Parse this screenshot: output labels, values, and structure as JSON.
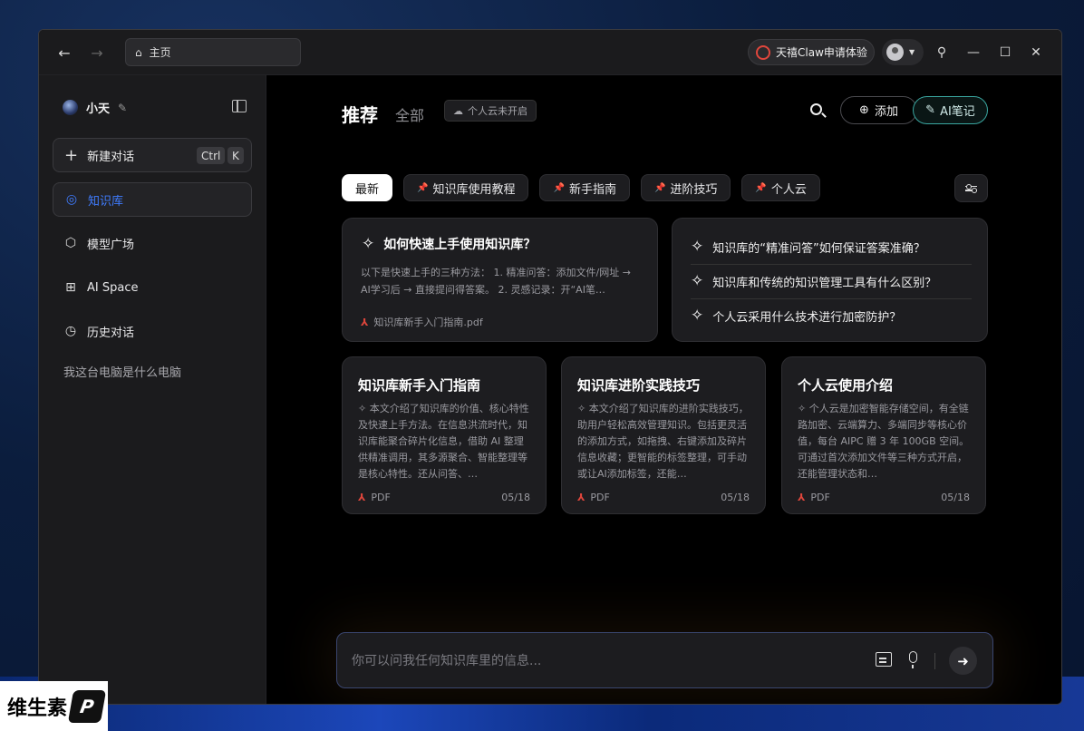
{
  "titlebar": {
    "address": "主页",
    "promo": "天禧Claw申请体验"
  },
  "sidebar": {
    "user_name": "小天",
    "new_chat": "新建对话",
    "shortcut_ctrl": "Ctrl",
    "shortcut_k": "K",
    "items": [
      {
        "label": "知识库",
        "icon": "bulb-search-icon"
      },
      {
        "label": "模型广场",
        "icon": "cube-icon"
      },
      {
        "label": "AI Space",
        "icon": "apps-icon"
      },
      {
        "label": "历史对话",
        "icon": "clock-icon"
      }
    ],
    "history": [
      "我这台电脑是什么电脑"
    ]
  },
  "header": {
    "tab_recommend": "推荐",
    "tab_all": "全部",
    "cloud_status": "个人云未开启",
    "add_label": "添加",
    "ai_note_label": "AI笔记"
  },
  "filters": [
    "最新",
    "知识库使用教程",
    "新手指南",
    "进阶技巧",
    "个人云"
  ],
  "feature_card": {
    "title": "如何快速上手使用知识库？",
    "description": "以下是快速上手的三种方法： 1. 精准问答：添加文件/网址 → AI学习后 → 直接提问得答案。 2. 灵感记录：开“AI笔…",
    "file_name": "知识库新手入门指南.pdf"
  },
  "questions": [
    "知识库的“精准问答”如何保证答案准确？",
    "知识库和传统的知识管理工具有什么区别？",
    "个人云采用什么技术进行加密防护？"
  ],
  "documents": [
    {
      "title": "知识库新手入门指南",
      "description": "✧ 本文介绍了知识库的价值、核心特性及快速上手方法。在信息洪流时代，知识库能聚合碎片化信息，借助 AI 整理供精准调用，其多源聚合、智能整理等是核心特性。还从问答、…",
      "kind": "PDF",
      "date": "05/18"
    },
    {
      "title": "知识库进阶实践技巧",
      "description": "✧ 本文介绍了知识库的进阶实践技巧，助用户轻松高效管理知识。包括更灵活的添加方式，如拖拽、右键添加及碎片信息收藏；更智能的标签整理，可手动或让AI添加标签，还能…",
      "kind": "PDF",
      "date": "05/18"
    },
    {
      "title": "个人云使用介绍",
      "description": "✧ 个人云是加密智能存储空间，有全链路加密、云端算力、多端同步等核心价值，每台 AIPC 赠 3 年 100GB 空间。可通过首次添加文件等三种方式开启，还能管理状态和…",
      "kind": "PDF",
      "date": "05/18"
    }
  ],
  "chat": {
    "placeholder": "你可以问我任何知识库里的信息..."
  },
  "watermark": {
    "text": "维生素",
    "mark": "P"
  },
  "colors": {
    "accent_blue": "#3f7cff",
    "ai_note_border": "#3aa6a0",
    "pdf_red": "#e0463c"
  }
}
